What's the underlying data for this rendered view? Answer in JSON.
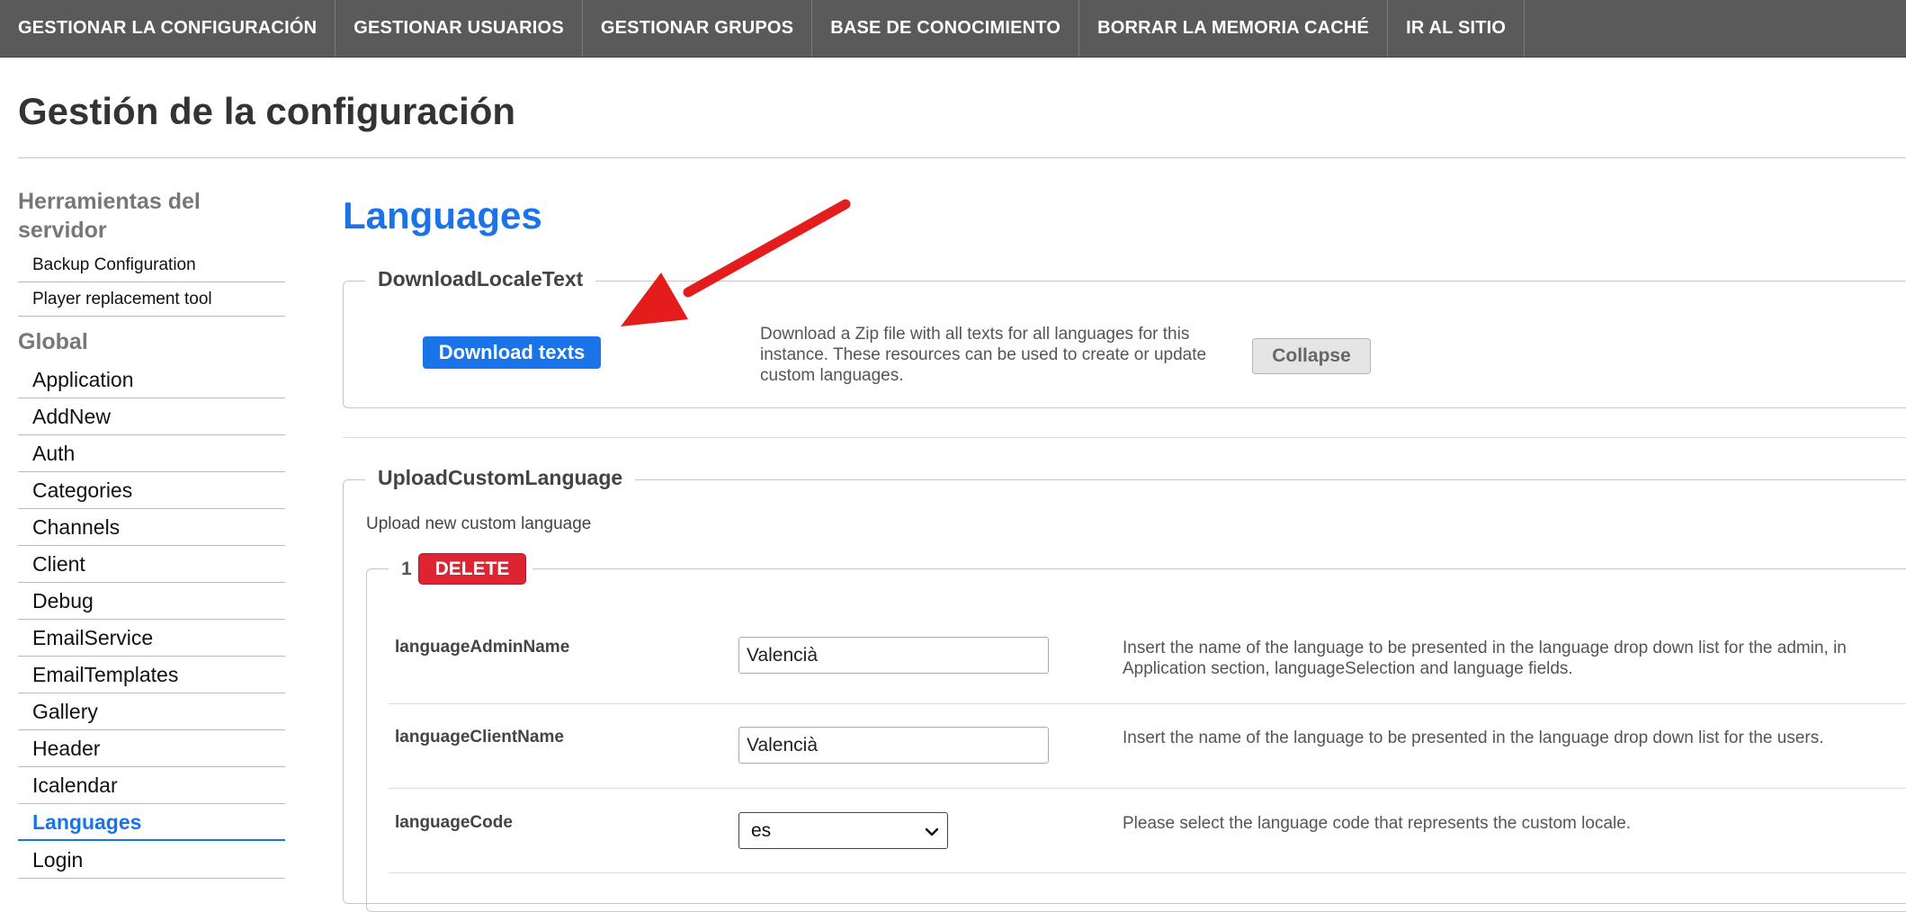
{
  "topnav": {
    "items": [
      "GESTIONAR LA CONFIGURACIÓN",
      "GESTIONAR USUARIOS",
      "GESTIONAR GRUPOS",
      "BASE DE CONOCIMIENTO",
      "BORRAR LA MEMORIA CACHÉ",
      "IR AL SITIO"
    ]
  },
  "page": {
    "title": "Gestión de la configuración"
  },
  "sidebar": {
    "server_heading": "Herramientas del servidor",
    "server_items": [
      "Backup Configuration",
      "Player replacement tool"
    ],
    "global_heading": "Global",
    "global_items": [
      "Application",
      "AddNew",
      "Auth",
      "Categories",
      "Channels",
      "Client",
      "Debug",
      "EmailService",
      "EmailTemplates",
      "Gallery",
      "Header",
      "Icalendar",
      "Languages",
      "Login"
    ],
    "active_item": "Languages"
  },
  "main": {
    "section_title": "Languages",
    "download": {
      "legend": "DownloadLocaleText",
      "button_label": "Download texts",
      "description": "Download a Zip file with all texts for all languages for this instance. These resources can be used to create or update custom languages.",
      "collapse_label": "Collapse"
    },
    "upload": {
      "legend": "UploadCustomLanguage",
      "description": "Upload new custom language",
      "entry": {
        "number": "1",
        "delete_label": "DELETE",
        "fields": {
          "admin_name": {
            "label": "languageAdminName",
            "value": "Valencià",
            "help": "Insert the name of the language to be presented in the language drop down list for the admin, in Application section, languageSelection and language fields."
          },
          "client_name": {
            "label": "languageClientName",
            "value": "Valencià",
            "help": "Insert the name of the language to be presented in the language drop down list for the users."
          },
          "code": {
            "label": "languageCode",
            "value": "es",
            "help": "Please select the language code that represents the custom locale."
          }
        }
      }
    }
  },
  "colors": {
    "nav_bg": "#5a5a5a",
    "accent": "#1b73e8",
    "danger": "#dc2433",
    "annotation_arrow": "#e41c1c"
  },
  "icons": {
    "select": "chevron-down-icon",
    "annotation": "red-arrow-icon"
  }
}
